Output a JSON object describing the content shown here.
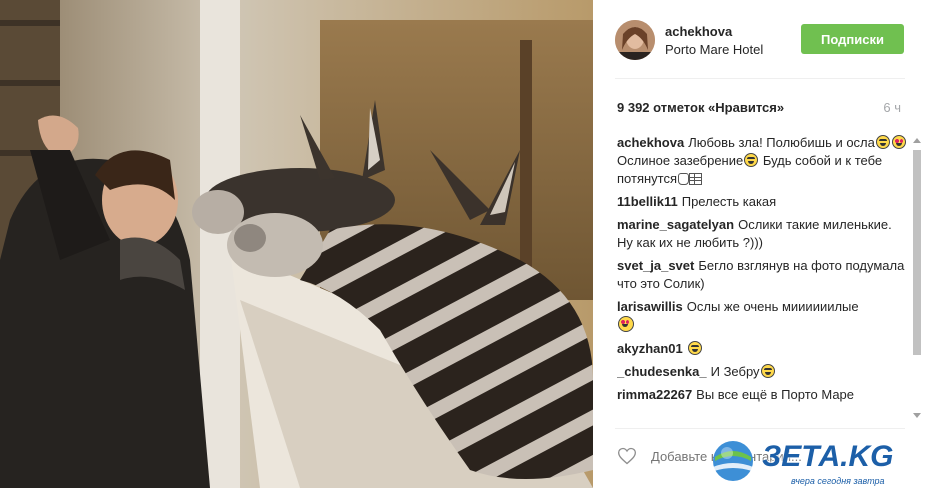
{
  "post": {
    "username": "achekhova",
    "location": "Porto Mare Hotel",
    "follow_label": "Подписки",
    "likes": "9 392 отметок «Нравится»",
    "time": "6 ч",
    "comment_placeholder": "Добавьте комментарий..."
  },
  "comments": [
    {
      "user": "achekhova",
      "text_a": "Любовь зла! Полюбишь и осла",
      "text_b": " Ослиное зазебрение",
      "text_c": " Будь собой и к тебе потянутся"
    },
    {
      "user": "11bellik11",
      "text": "Прелесть какая"
    },
    {
      "user": "marine_sagatelyan",
      "text": "Ослики такие миленькие. Ну как их не любить ?)))"
    },
    {
      "user": "svet_ja_svet",
      "text": "Бегло взглянув на фото подумала что это Солик)"
    },
    {
      "user": "larisawillis",
      "text": "Ослы же очень миииииилые"
    },
    {
      "user": "akyzhan01",
      "text": ""
    },
    {
      "user": "_chudesenka_",
      "text": "И Зебру"
    },
    {
      "user": "rimma22267",
      "text": "Вы все ещё в Порто Маре"
    }
  ],
  "icons": {
    "heart": "heart-outline-icon",
    "avatar": "user-avatar",
    "emoji": "emoji-icon"
  },
  "watermark": {
    "text": "ЗЕТА.KG",
    "tagline": "вчера сегодня завтра"
  },
  "colors": {
    "follow_button": "#70c050",
    "watermark": "#1c5fa8",
    "muted": "#a5a7aa"
  }
}
